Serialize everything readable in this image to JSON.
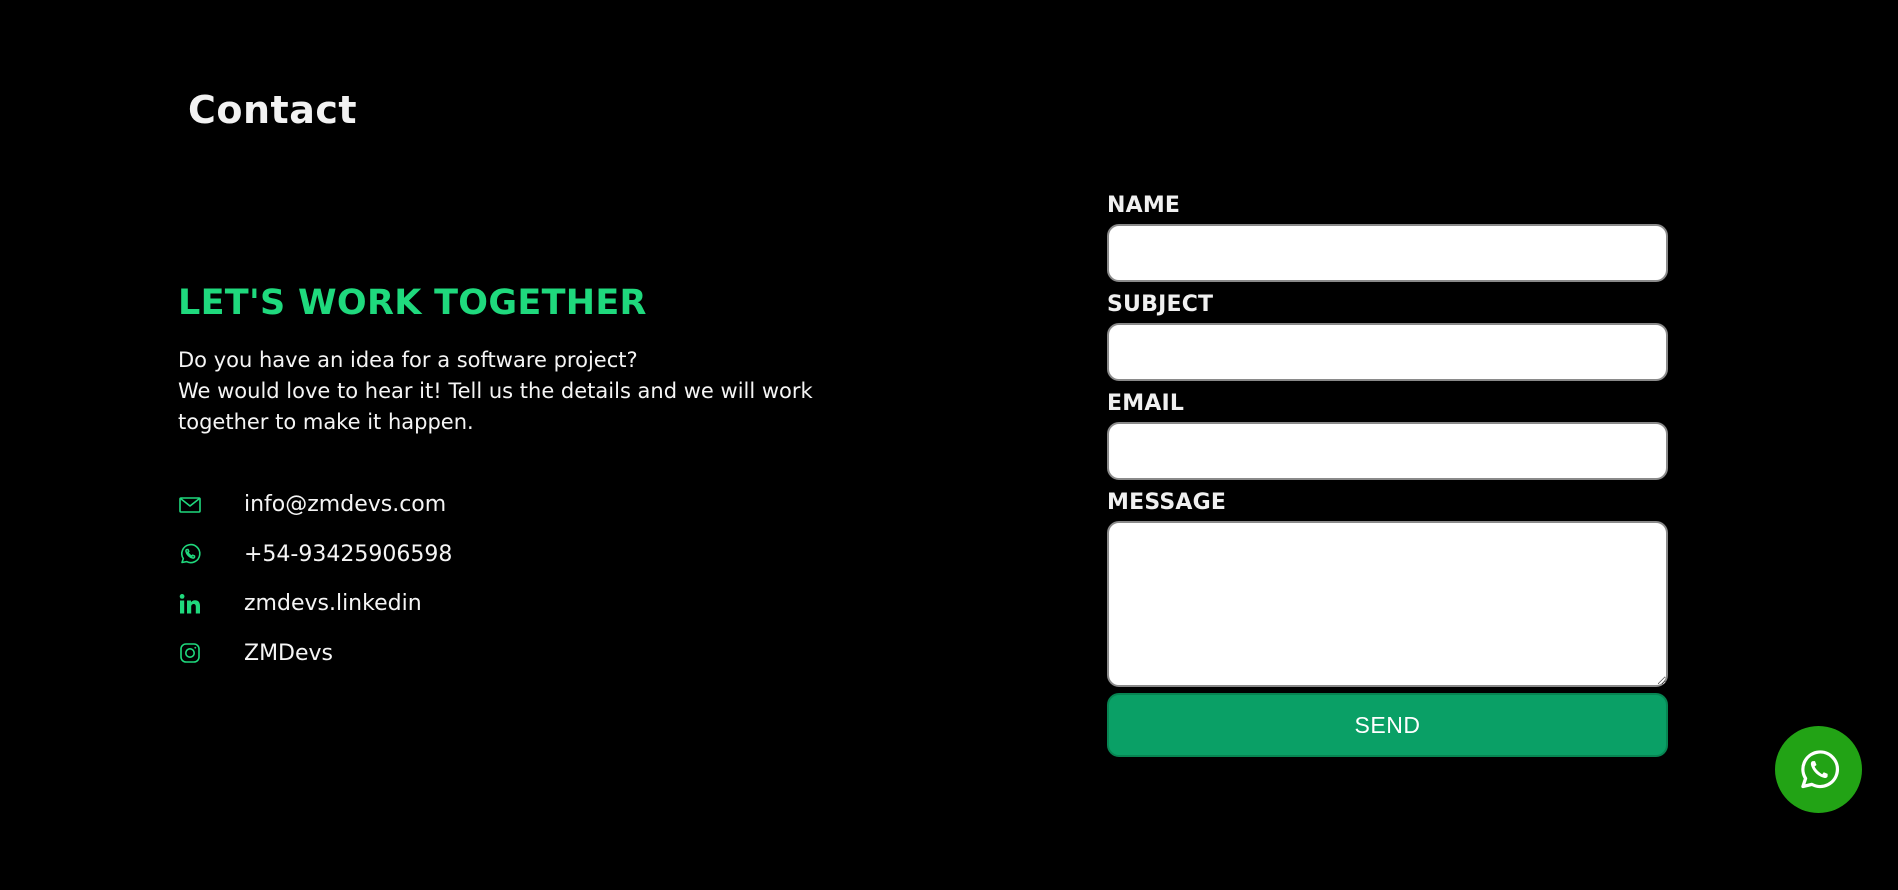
{
  "section": {
    "title": "Contact"
  },
  "intro": {
    "headline": "LET'S WORK TOGETHER",
    "lines": [
      "Do you have an idea for a software project?",
      "We would love to hear it! Tell us the details and we will work",
      "together to make it happen."
    ]
  },
  "contacts": [
    {
      "icon": "mail-icon",
      "value": "info@zmdevs.com"
    },
    {
      "icon": "whatsapp-icon",
      "value": "+54-93425906598"
    },
    {
      "icon": "linkedin-icon",
      "value": "zmdevs.linkedin"
    },
    {
      "icon": "instagram-icon",
      "value": "ZMDevs"
    }
  ],
  "form": {
    "name_label": "NAME",
    "name_value": "",
    "subject_label": "SUBJECT",
    "subject_value": "",
    "email_label": "EMAIL",
    "email_value": "",
    "message_label": "MESSAGE",
    "message_value": "",
    "send_label": "SEND"
  },
  "floating_button": {
    "icon": "whatsapp-icon"
  },
  "colors": {
    "background": "#000000",
    "accent": "#1fd97d",
    "send_button": "#0aa066",
    "whatsapp_float": "#22a315"
  }
}
